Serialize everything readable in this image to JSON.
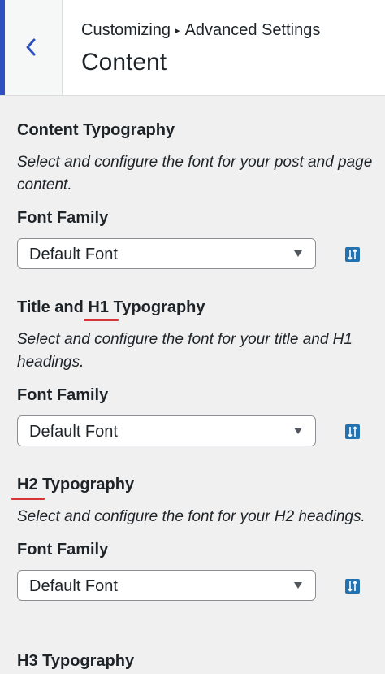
{
  "header": {
    "back_icon": "chevron-left-icon",
    "breadcrumb_parent": "Customizing",
    "breadcrumb_separator": "▸",
    "breadcrumb_current": "Advanced Settings",
    "title": "Content"
  },
  "sections": [
    {
      "title": "Content Typography",
      "description": "Select and configure the font for your post and page content.",
      "field_label": "Font Family",
      "select_value": "Default Font",
      "adv_icon": "advanced-settings-icon"
    },
    {
      "title": "Title and H1 Typography",
      "description": "Select and configure the font for your title and H1 headings.",
      "field_label": "Font Family",
      "select_value": "Default Font",
      "adv_icon": "advanced-settings-icon"
    },
    {
      "title": "H2 Typography",
      "description": "Select and configure the font for your H2 headings.",
      "field_label": "Font Family",
      "select_value": "Default Font",
      "adv_icon": "advanced-settings-icon"
    },
    {
      "title": "H3 Typography"
    }
  ],
  "colors": {
    "accent": "#2e4fbf",
    "button": "#2271b1",
    "annotation": "#d63638"
  }
}
